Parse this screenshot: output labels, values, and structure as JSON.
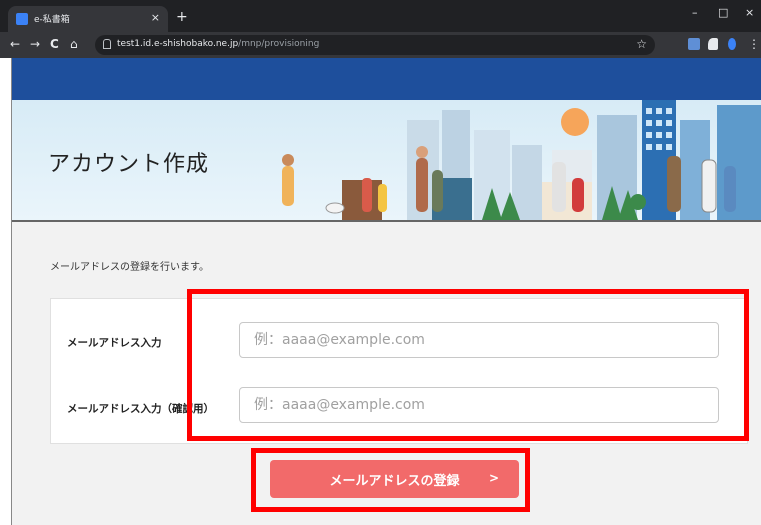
{
  "browser": {
    "tab_title": "e-私書箱",
    "tab_close": "×",
    "new_tab": "+",
    "window_controls": {
      "minimize": "–",
      "maximize": "□",
      "close": "×"
    },
    "nav": {
      "back": "←",
      "forward": "→",
      "reload": "C",
      "home": "⌂"
    },
    "url_host": "test1.id.e-shishobako.ne.jp",
    "url_path": "/mnp/provisioning",
    "star": "☆"
  },
  "page": {
    "title": "アカウント作成",
    "description": "メールアドレスの登録を行います。",
    "form": {
      "email_label": "メールアドレス入力",
      "email_placeholder": "例：aaaa@example.com",
      "email_confirm_label": "メールアドレス入力（確認用）",
      "email_confirm_placeholder": "例：aaaa@example.com"
    },
    "submit_label": "メールアドレスの登録",
    "submit_arrow": ">"
  },
  "colors": {
    "header_blue": "#1e4f9c",
    "button_red": "#f26a6a",
    "highlight": "#ff0000"
  }
}
